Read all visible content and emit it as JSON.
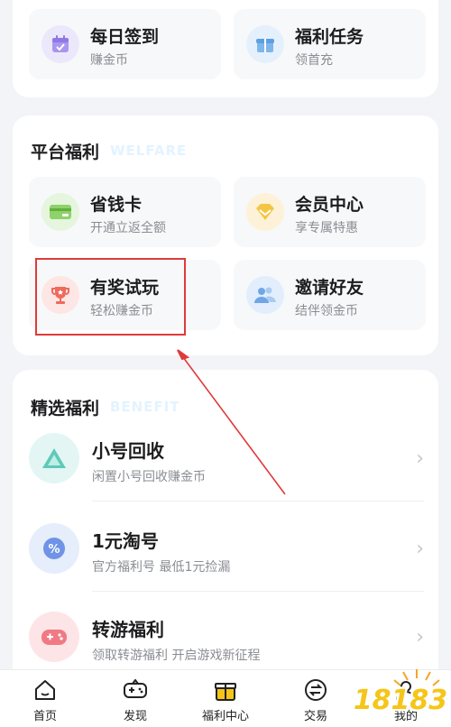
{
  "top_card": {
    "tiles": [
      {
        "title": "每日签到",
        "subtitle": "赚金币",
        "icon": "calendar-icon"
      },
      {
        "title": "福利任务",
        "subtitle": "领首充",
        "icon": "gift-icon"
      }
    ]
  },
  "platform": {
    "title": "平台福利",
    "ghost": "WELFARE",
    "tiles": [
      {
        "title": "省钱卡",
        "subtitle": "开通立返全额",
        "icon": "card-icon"
      },
      {
        "title": "会员中心",
        "subtitle": "享专属特惠",
        "icon": "diamond-icon"
      },
      {
        "title": "有奖试玩",
        "subtitle": "轻松赚金币",
        "icon": "trophy-icon"
      },
      {
        "title": "邀请好友",
        "subtitle": "结伴领金币",
        "icon": "friends-icon"
      }
    ]
  },
  "selected": {
    "title": "精选福利",
    "ghost": "BENEFIT",
    "rows": [
      {
        "title": "小号回收",
        "subtitle": "闲置小号回收赚金币",
        "icon": "recycle-icon"
      },
      {
        "title": "1元淘号",
        "subtitle": "官方福利号 最低1元捡漏",
        "icon": "discount-icon"
      },
      {
        "title": "转游福利",
        "subtitle": "领取转游福利 开启游戏新征程",
        "icon": "gamepad-icon"
      }
    ],
    "chevron": "›"
  },
  "tabbar": {
    "tabs": [
      {
        "label": "首页",
        "icon": "home-icon"
      },
      {
        "label": "发现",
        "icon": "gamepad-icon"
      },
      {
        "label": "福利中心",
        "icon": "gift-box-icon"
      },
      {
        "label": "交易",
        "icon": "exchange-icon"
      },
      {
        "label": "我的",
        "icon": "profile-icon"
      }
    ]
  },
  "watermark": "18183",
  "colors": {
    "accent": "#f5c518",
    "highlight": "#e03a3a",
    "card": "#ffffff",
    "bg": "#f2f4f7"
  }
}
